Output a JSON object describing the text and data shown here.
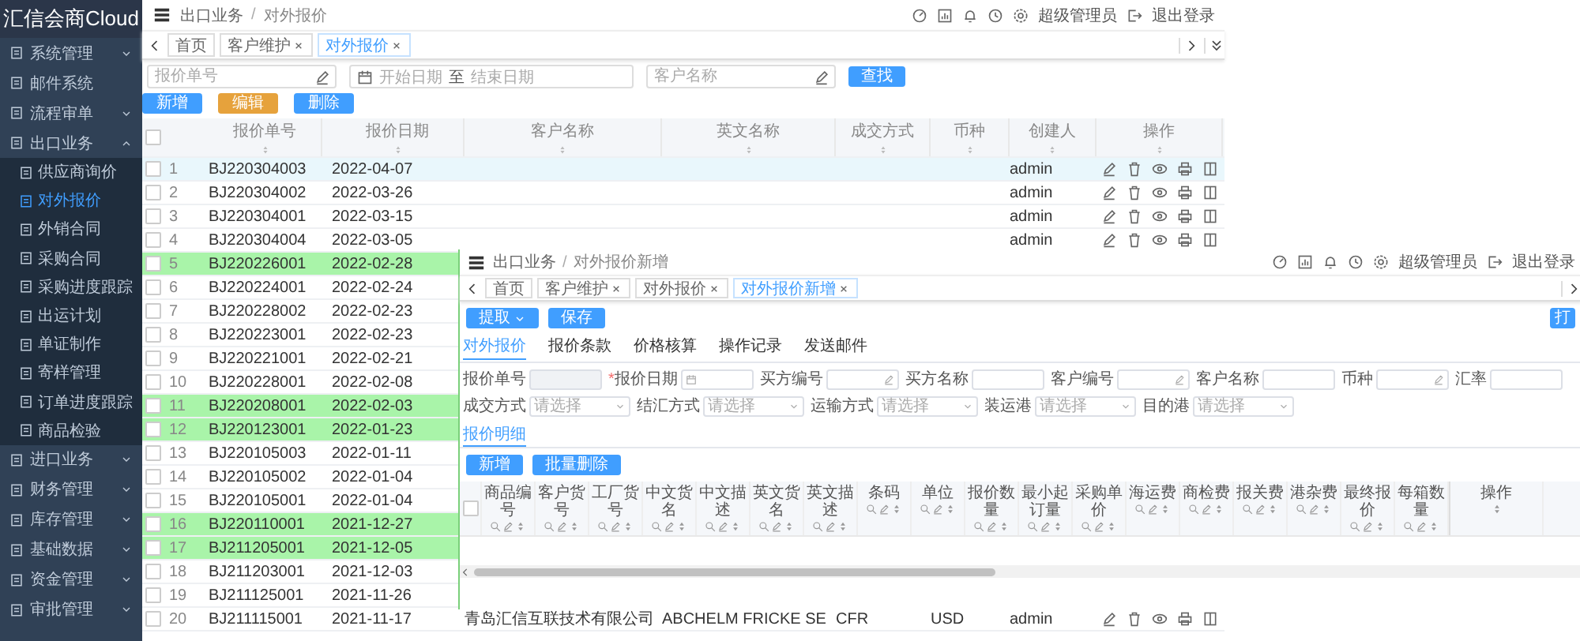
{
  "sidebar": {
    "logo": "汇信会商Cloud",
    "items": [
      {
        "label": "系统管理",
        "expanded": false
      },
      {
        "label": "邮件系统"
      },
      {
        "label": "流程审单",
        "expanded": false
      },
      {
        "label": "出口业务",
        "expanded": true,
        "children": [
          {
            "label": "供应商询价",
            "selected": false
          },
          {
            "label": "对外报价",
            "selected": true
          },
          {
            "label": "外销合同",
            "selected": false
          },
          {
            "label": "采购合同",
            "selected": false
          },
          {
            "label": "采购进度跟踪",
            "selected": false
          },
          {
            "label": "出运计划",
            "selected": false
          },
          {
            "label": "单证制作",
            "selected": false
          },
          {
            "label": "寄样管理",
            "selected": false
          },
          {
            "label": "订单进度跟踪",
            "selected": false
          },
          {
            "label": "商品检验",
            "selected": false
          }
        ]
      },
      {
        "label": "进口业务",
        "expanded": false
      },
      {
        "label": "财务管理",
        "expanded": false
      },
      {
        "label": "库存管理",
        "expanded": false
      },
      {
        "label": "基础数据",
        "expanded": false
      },
      {
        "label": "资金管理",
        "expanded": false
      },
      {
        "label": "审批管理",
        "expanded": false
      }
    ]
  },
  "topbar": {
    "breadcrumb": [
      "出口业务",
      "对外报价"
    ],
    "separator": "/",
    "user": "超级管理员",
    "logout": "退出登录"
  },
  "tabs": [
    {
      "label": "首页",
      "closable": false,
      "selected": false
    },
    {
      "label": "客户维护",
      "closable": true,
      "selected": false
    },
    {
      "label": "对外报价",
      "closable": true,
      "selected": true
    }
  ],
  "filters": {
    "code_placeholder": "报价单号",
    "start_placeholder": "开始日期",
    "range_separator": "至",
    "end_placeholder": "结束日期",
    "customer_placeholder": "客户名称",
    "search_button": "查找"
  },
  "actions": [
    {
      "label": "新增",
      "color": "#409eff"
    },
    {
      "label": "编辑",
      "color": "#e6a23c"
    },
    {
      "label": "删除",
      "color": "#409eff"
    }
  ],
  "table": {
    "select_all_checked": false,
    "columns": [
      "报价单号",
      "报价日期",
      "客户名称",
      "英文名称",
      "成交方式",
      "币种",
      "创建人",
      "操作"
    ],
    "rows": [
      {
        "no": "1",
        "code": "BJ220304003",
        "date": "2022-04-07",
        "creator": "admin",
        "current": true,
        "highlighted": false
      },
      {
        "no": "2",
        "code": "BJ220304002",
        "date": "2022-03-26",
        "creator": "admin",
        "current": false,
        "highlighted": false
      },
      {
        "no": "3",
        "code": "BJ220304001",
        "date": "2022-03-15",
        "creator": "admin",
        "current": false,
        "highlighted": false
      },
      {
        "no": "4",
        "code": "BJ220304004",
        "date": "2022-03-05",
        "creator": "admin",
        "current": false,
        "highlighted": false
      },
      {
        "no": "5",
        "code": "BJ220226001",
        "date": "2022-02-28",
        "current": false,
        "highlighted": true
      },
      {
        "no": "6",
        "code": "BJ220224001",
        "date": "2022-02-24",
        "current": false,
        "highlighted": false
      },
      {
        "no": "7",
        "code": "BJ220228002",
        "date": "2022-02-23",
        "current": false,
        "highlighted": false
      },
      {
        "no": "8",
        "code": "BJ220223001",
        "date": "2022-02-23",
        "current": false,
        "highlighted": false
      },
      {
        "no": "9",
        "code": "BJ220221001",
        "date": "2022-02-21",
        "current": false,
        "highlighted": false
      },
      {
        "no": "10",
        "code": "BJ220228001",
        "date": "2022-02-08",
        "current": false,
        "highlighted": false
      },
      {
        "no": "11",
        "code": "BJ220208001",
        "date": "2022-02-03",
        "current": false,
        "highlighted": true
      },
      {
        "no": "12",
        "code": "BJ220123001",
        "date": "2022-01-23",
        "current": false,
        "highlighted": true
      },
      {
        "no": "13",
        "code": "BJ220105003",
        "date": "2022-01-11",
        "current": false,
        "highlighted": false
      },
      {
        "no": "14",
        "code": "BJ220105002",
        "date": "2022-01-04",
        "current": false,
        "highlighted": false
      },
      {
        "no": "15",
        "code": "BJ220105001",
        "date": "2022-01-04",
        "current": false,
        "highlighted": false
      },
      {
        "no": "16",
        "code": "BJ220110001",
        "date": "2021-12-27",
        "current": false,
        "highlighted": true
      },
      {
        "no": "17",
        "code": "BJ211205001",
        "date": "2021-12-05",
        "current": false,
        "highlighted": true
      },
      {
        "no": "18",
        "code": "BJ211203001",
        "date": "2021-12-03",
        "current": false,
        "highlighted": false
      },
      {
        "no": "19",
        "code": "BJ211125001",
        "date": "2021-11-26",
        "current": false,
        "highlighted": false
      },
      {
        "no": "20",
        "code": "BJ211115001",
        "date": "2021-11-17",
        "customer": "青岛汇信互联技术有限公司",
        "english_name": "ABCHELM FRICKE SE",
        "deal_method": "CFR",
        "currency": "USD",
        "creator": "admin",
        "current": false,
        "highlighted": false
      }
    ]
  },
  "overlay": {
    "topbar": {
      "breadcrumb": [
        "出口业务",
        "对外报价新增"
      ],
      "separator": "/",
      "user": "超级管理员",
      "logout": "退出登录"
    },
    "tabs": [
      {
        "label": "首页",
        "closable": false,
        "selected": false
      },
      {
        "label": "客户维护",
        "closable": true,
        "selected": false
      },
      {
        "label": "对外报价",
        "closable": true,
        "selected": false
      },
      {
        "label": "对外报价新增",
        "closable": true,
        "selected": true
      }
    ],
    "extract_button": "提取",
    "save_button": "保存",
    "print_button": "打",
    "form_tabs": [
      {
        "label": "对外报价",
        "selected": true
      },
      {
        "label": "报价条款",
        "selected": false
      },
      {
        "label": "价格核算",
        "selected": false
      },
      {
        "label": "操作记录",
        "selected": false
      },
      {
        "label": "发送邮件",
        "selected": false
      }
    ],
    "form_rows": [
      [
        {
          "label": "报价单号",
          "kind": "disabled"
        },
        {
          "label": "报价日期",
          "required_mark": "*",
          "kind": "date"
        },
        {
          "label": "买方编号",
          "kind": "lookup"
        },
        {
          "label": "买方名称",
          "kind": "text"
        },
        {
          "label": "客户编号",
          "kind": "lookup"
        },
        {
          "label": "客户名称",
          "kind": "text"
        },
        {
          "label": "币种",
          "kind": "lookup"
        },
        {
          "label": "汇率",
          "kind": "text"
        }
      ],
      [
        {
          "label": "成交方式",
          "kind": "select",
          "placeholder": "请选择"
        },
        {
          "label": "结汇方式",
          "kind": "select",
          "placeholder": "请选择"
        },
        {
          "label": "运输方式",
          "kind": "select",
          "placeholder": "请选择"
        },
        {
          "label": "装运港",
          "kind": "select",
          "placeholder": "请选择"
        },
        {
          "label": "目的港",
          "kind": "select",
          "placeholder": "请选择"
        }
      ]
    ],
    "detail_tab": "报价明细",
    "add_button": "新增",
    "batch_delete_button": "批量删除",
    "grid_select_all_checked": false,
    "grid_columns": [
      "商品编号",
      "客户货号",
      "工厂货号",
      "中文货名",
      "中文描述",
      "英文货名",
      "英文描述",
      "条码",
      "单位",
      "报价数量",
      "最小起订量",
      "采购单价",
      "海运费",
      "商检费",
      "报关费",
      "港杂费",
      "最终报价",
      "每箱数量"
    ],
    "grid_ops_column": "操作"
  }
}
